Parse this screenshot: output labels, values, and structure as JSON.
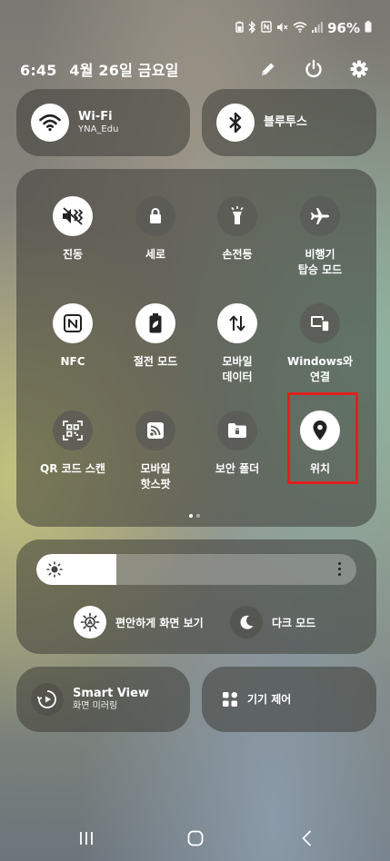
{
  "status_bar": {
    "battery_text": "96%",
    "icons": [
      "battery-saver-icon",
      "bluetooth-icon",
      "nfc-icon",
      "mute-icon",
      "wifi-icon",
      "signal-icon",
      "battery-icon"
    ]
  },
  "header": {
    "time": "6:45",
    "date": "4월 26일 금요일",
    "icons": [
      "edit-icon",
      "power-icon",
      "settings-icon"
    ]
  },
  "wifi": {
    "title": "Wi-Fi",
    "network": "YNA_Edu",
    "active": true
  },
  "bluetooth": {
    "title": "블루투스",
    "active": true
  },
  "quick_tiles": [
    {
      "id": "vibrate",
      "label": "진동",
      "icon": "vibrate-icon",
      "active": true
    },
    {
      "id": "rotation",
      "label": "세로",
      "icon": "rotation-lock-icon",
      "active": false
    },
    {
      "id": "flashlight",
      "label": "손전등",
      "icon": "flashlight-icon",
      "active": false
    },
    {
      "id": "airplane",
      "label": "비행기\n탑승 모드",
      "icon": "airplane-icon",
      "active": false
    },
    {
      "id": "nfc",
      "label": "NFC",
      "icon": "nfc-icon",
      "active": true
    },
    {
      "id": "power-saving",
      "label": "절전 모드",
      "icon": "power-saving-icon",
      "active": true
    },
    {
      "id": "mobile-data",
      "label": "모바일\n데이터",
      "icon": "mobile-data-icon",
      "active": true
    },
    {
      "id": "windows",
      "label": "Windows와\n연결",
      "icon": "link-to-windows-icon",
      "active": false
    },
    {
      "id": "qr",
      "label": "QR 코드 스캔",
      "icon": "qr-scan-icon",
      "active": false
    },
    {
      "id": "hotspot",
      "label": "모바일\n핫스팟",
      "icon": "hotspot-icon",
      "active": false
    },
    {
      "id": "secure-folder",
      "label": "보안 폴더",
      "icon": "secure-folder-icon",
      "active": false
    },
    {
      "id": "location",
      "label": "위치",
      "icon": "location-icon",
      "active": true
    }
  ],
  "page_indicator": {
    "current": 1,
    "total": 2
  },
  "highlight_color": "#e02020",
  "brightness": {
    "level_fraction": 0.25,
    "sun_icon": "brightness-icon",
    "more_icon": "more-vertical-icon"
  },
  "eye_comfort": {
    "label": "편안하게 화면 보기",
    "icon": "eye-comfort-icon",
    "active": true
  },
  "dark_mode": {
    "label": "다크 모드",
    "icon": "moon-icon",
    "active": false
  },
  "smart_view": {
    "title": "Smart View",
    "subtitle": "화면 미러링",
    "icon": "smart-view-icon"
  },
  "device_control": {
    "label": "기기 제어",
    "icon": "device-control-icon"
  },
  "nav_bar": [
    "recent-apps-icon",
    "home-icon",
    "back-icon"
  ]
}
